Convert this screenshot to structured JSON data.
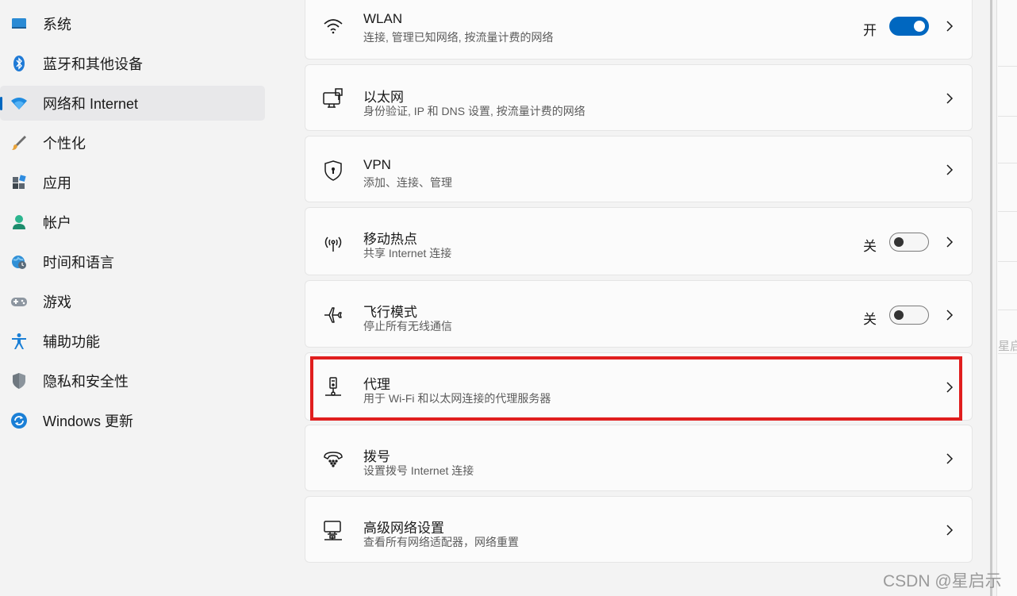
{
  "sidebar": {
    "items": [
      {
        "label": "系统",
        "icon": "system-icon"
      },
      {
        "label": "蓝牙和其他设备",
        "icon": "bluetooth-icon"
      },
      {
        "label": "网络和 Internet",
        "icon": "network-icon",
        "active": true
      },
      {
        "label": "个性化",
        "icon": "brush-icon"
      },
      {
        "label": "应用",
        "icon": "apps-icon"
      },
      {
        "label": "帐户",
        "icon": "account-icon"
      },
      {
        "label": "时间和语言",
        "icon": "globe-clock-icon"
      },
      {
        "label": "游戏",
        "icon": "gamepad-icon"
      },
      {
        "label": "辅助功能",
        "icon": "accessibility-icon"
      },
      {
        "label": "隐私和安全性",
        "icon": "shield-icon"
      },
      {
        "label": "Windows 更新",
        "icon": "update-icon"
      }
    ]
  },
  "cards": [
    {
      "title": "WLAN",
      "subtitle": "连接, 管理已知网络, 按流量计费的网络",
      "state": "开",
      "toggle_on": true
    },
    {
      "title": "以太网",
      "subtitle": "身份验证, IP 和 DNS 设置, 按流量计费的网络"
    },
    {
      "title": "VPN",
      "subtitle": "添加、连接、管理"
    },
    {
      "title": "移动热点",
      "subtitle": "共享 Internet 连接",
      "state": "关",
      "toggle_on": false
    },
    {
      "title": "飞行模式",
      "subtitle": "停止所有无线通信",
      "state": "关",
      "toggle_on": false
    },
    {
      "title": "代理",
      "subtitle": "用于 Wi-Fi 和以太网连接的代理服务器",
      "highlighted": true
    },
    {
      "title": "拨号",
      "subtitle": "设置拨号 Internet 连接"
    },
    {
      "title": "高级网络设置",
      "subtitle": "查看所有网络适配器，网络重置"
    }
  ],
  "right_panel_text": "星启",
  "watermark": "CSDN @星启示",
  "colors": {
    "accent": "#0067c0",
    "highlight": "#e01e1e",
    "background": "#f3f3f3"
  }
}
